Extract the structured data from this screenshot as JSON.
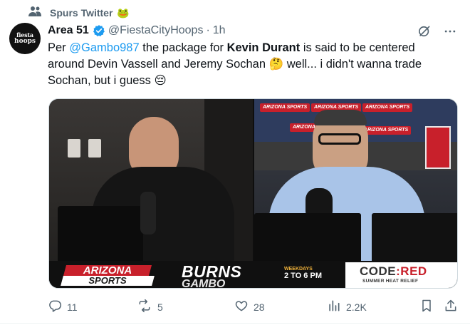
{
  "context": {
    "label": "Spurs Twitter",
    "emoji": "🐸"
  },
  "avatar": {
    "line1": "fiesta",
    "line2": "hoops"
  },
  "tweet": {
    "display_name": "Area 51",
    "handle": "@FiestaCityHoops",
    "separator": "·",
    "time": "1h",
    "text_parts": {
      "per": "Per ",
      "mention": "@Gambo987",
      "mid": " the package for ",
      "bold": "Kevin Durant",
      "rest": " is said to be centered around Devin Vassell and Jeremy Sochan 🤔 well... i didn't wanna trade Sochan, but i guess 😔"
    }
  },
  "media": {
    "network": "ARIZONA",
    "network_sub": "SPORTS",
    "show_line1": "BURNS",
    "show_line2": "GAMBO",
    "time_prefix": "WEEKDAYS",
    "time_text": "2 TO 6 PM",
    "sponsor_main_a": "CODE",
    "sponsor_sep": ":",
    "sponsor_main_b": "RED",
    "sponsor_sub": "SUMMER HEAT RELIEF",
    "wall_sign": "ARIZONA SPORTS"
  },
  "actions": {
    "replies": "11",
    "reposts": "5",
    "likes": "28",
    "views": "2.2K"
  },
  "colors": {
    "accent": "#1d9bf0",
    "muted": "#536471",
    "brand_red": "#c8202b"
  }
}
